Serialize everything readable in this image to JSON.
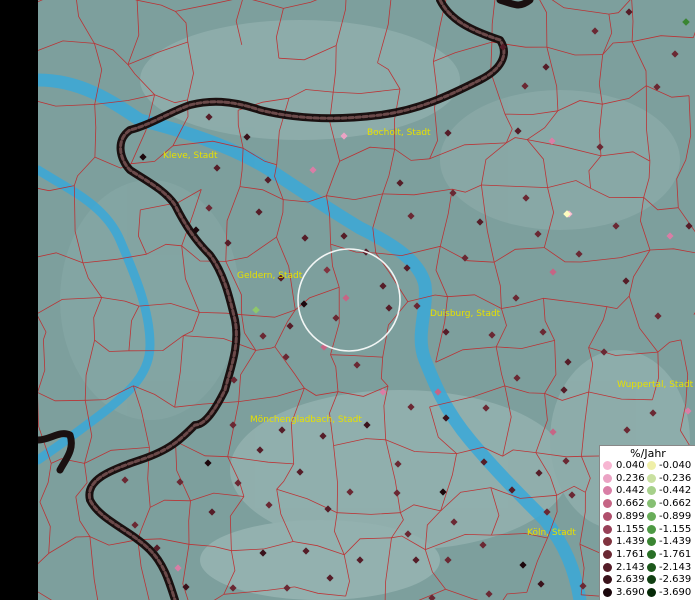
{
  "cities": [
    {
      "name": "Kleve, Stadt"
    },
    {
      "name": "Bocholt, Stadt"
    },
    {
      "name": "Geldern, Stadt"
    },
    {
      "name": "Duisburg, Stadt"
    },
    {
      "name": "Wuppertal, Stadt"
    },
    {
      "name": "Mönchengladbach, Stadt"
    },
    {
      "name": "Köln, Stadt"
    }
  ],
  "legend": {
    "title": "%/Jahr",
    "positive": [
      "0.040",
      "0.236",
      "0.442",
      "0.662",
      "0.899",
      "1.155",
      "1.439",
      "1.761",
      "2.143",
      "2.639",
      "3.690"
    ],
    "negative": [
      "-0.040",
      "-0.236",
      "-0.442",
      "-0.662",
      "-0.899",
      "-1.155",
      "-1.439",
      "-1.761",
      "-2.143",
      "-2.639",
      "-3.690"
    ],
    "positive_colors": [
      "#f7b6d2",
      "#eba3c4",
      "#d97ea6",
      "#c66585",
      "#b04f6c",
      "#984058",
      "#80333f",
      "#6a2833",
      "#551d28",
      "#3a121b",
      "#1c070c"
    ],
    "negative_colors": [
      "#efefa8",
      "#c9e0a0",
      "#a6d08a",
      "#86bf72",
      "#69ad59",
      "#4e9a44",
      "#3a8532",
      "#296f26",
      "#1c581b",
      "#114012",
      "#062a08"
    ]
  }
}
